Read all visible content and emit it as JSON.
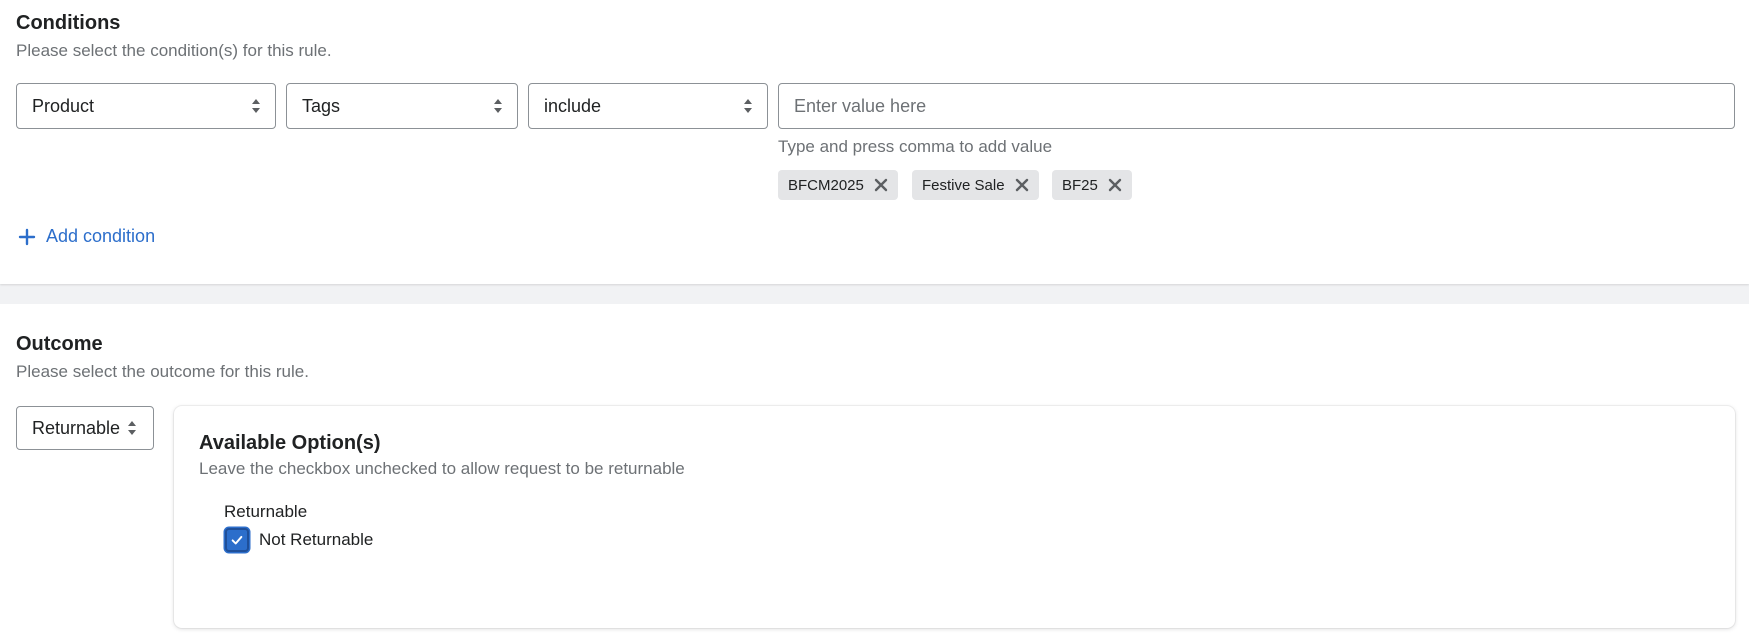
{
  "conditions": {
    "title": "Conditions",
    "subtitle": "Please select the condition(s) for this rule.",
    "field_select": "Product",
    "attribute_select": "Tags",
    "operator_select": "include",
    "value_placeholder": "Enter value here",
    "helper_text": "Type and press comma to add value",
    "tags": [
      "BFCM2025",
      "Festive Sale",
      "BF25"
    ],
    "add_condition_label": "Add condition"
  },
  "outcome": {
    "title": "Outcome",
    "subtitle": "Please select the outcome for this rule.",
    "outcome_select": "Returnable",
    "card": {
      "title": "Available Option(s)",
      "subtitle": "Leave the checkbox unchecked to allow request to be returnable",
      "group_label": "Returnable",
      "checkbox_label": "Not Returnable",
      "checkbox_checked": true
    }
  },
  "colors": {
    "accent": "#2c6ecb",
    "tag_background": "#e4e5e7",
    "page_background": "#f1f2f4"
  },
  "icons": [
    "select-caret-icon",
    "remove-tag-icon",
    "plus-icon",
    "checkmark-icon"
  ]
}
